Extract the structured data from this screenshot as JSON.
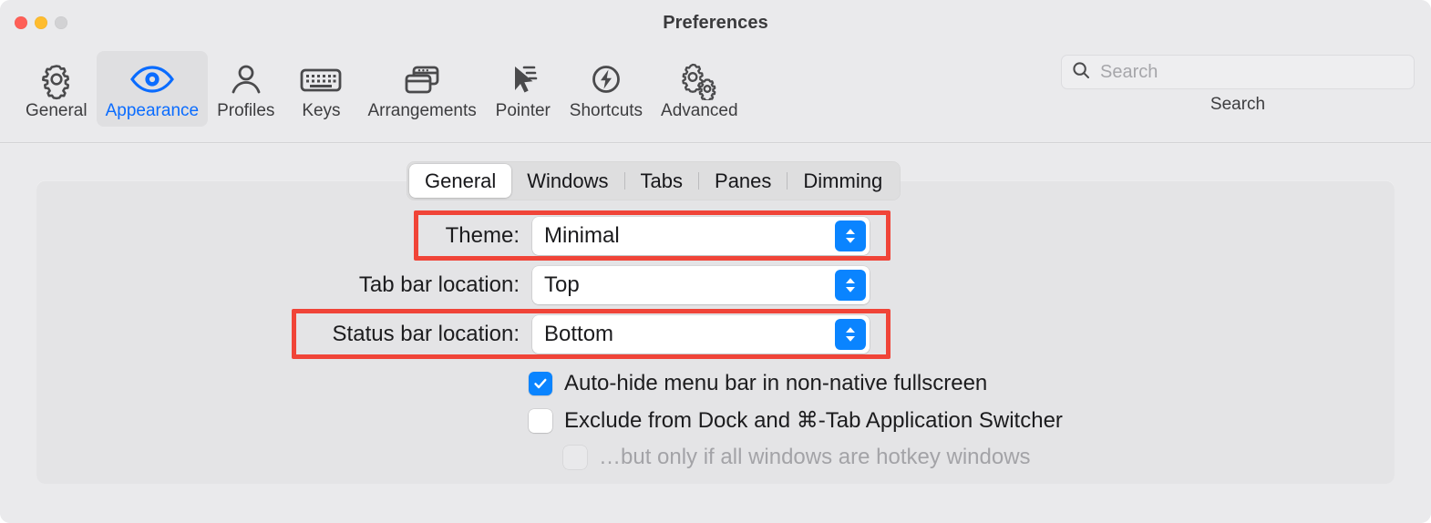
{
  "window": {
    "title": "Preferences",
    "traffic_lights": [
      {
        "name": "close",
        "color": "#ff5f57"
      },
      {
        "name": "minimize",
        "color": "#febc2e"
      },
      {
        "name": "zoom",
        "color": "#d2d2d4"
      }
    ]
  },
  "toolbar": {
    "items": [
      {
        "label": "General",
        "icon": "gear-icon",
        "selected": false
      },
      {
        "label": "Appearance",
        "icon": "eye-icon",
        "selected": true
      },
      {
        "label": "Profiles",
        "icon": "person-icon",
        "selected": false
      },
      {
        "label": "Keys",
        "icon": "keyboard-icon",
        "selected": false
      },
      {
        "label": "Arrangements",
        "icon": "windows-icon",
        "selected": false
      },
      {
        "label": "Pointer",
        "icon": "cursor-icon",
        "selected": false
      },
      {
        "label": "Shortcuts",
        "icon": "bolt-circle-icon",
        "selected": false
      },
      {
        "label": "Advanced",
        "icon": "double-gear-icon",
        "selected": false
      }
    ],
    "accent_color": "#0a6cff",
    "selected_background": "#dfdfe1"
  },
  "search": {
    "placeholder": "Search",
    "value": "",
    "caption": "Search",
    "icon": "search-icon"
  },
  "tabs": {
    "items": [
      {
        "label": "General",
        "active": true
      },
      {
        "label": "Windows",
        "active": false
      },
      {
        "label": "Tabs",
        "active": false
      },
      {
        "label": "Panes",
        "active": false
      },
      {
        "label": "Dimming",
        "active": false
      }
    ]
  },
  "form": {
    "popups": [
      {
        "label": "Theme:",
        "value": "Minimal",
        "highlighted": true
      },
      {
        "label": "Tab bar location:",
        "value": "Top",
        "highlighted": false
      },
      {
        "label": "Status bar location:",
        "value": "Bottom",
        "highlighted": true
      }
    ],
    "checkboxes": [
      {
        "label": "Auto-hide menu bar in non-native fullscreen",
        "checked": true,
        "disabled": false
      },
      {
        "label": "Exclude from Dock and ⌘-Tab Application Switcher",
        "checked": false,
        "disabled": false
      },
      {
        "label": "…but only if all windows are hotkey windows",
        "checked": false,
        "disabled": true
      }
    ]
  },
  "colors": {
    "accent": "#0a84ff",
    "highlight_outline": "#f04438",
    "window_background": "#eaeaec",
    "panel_background": "#e4e4e6"
  }
}
